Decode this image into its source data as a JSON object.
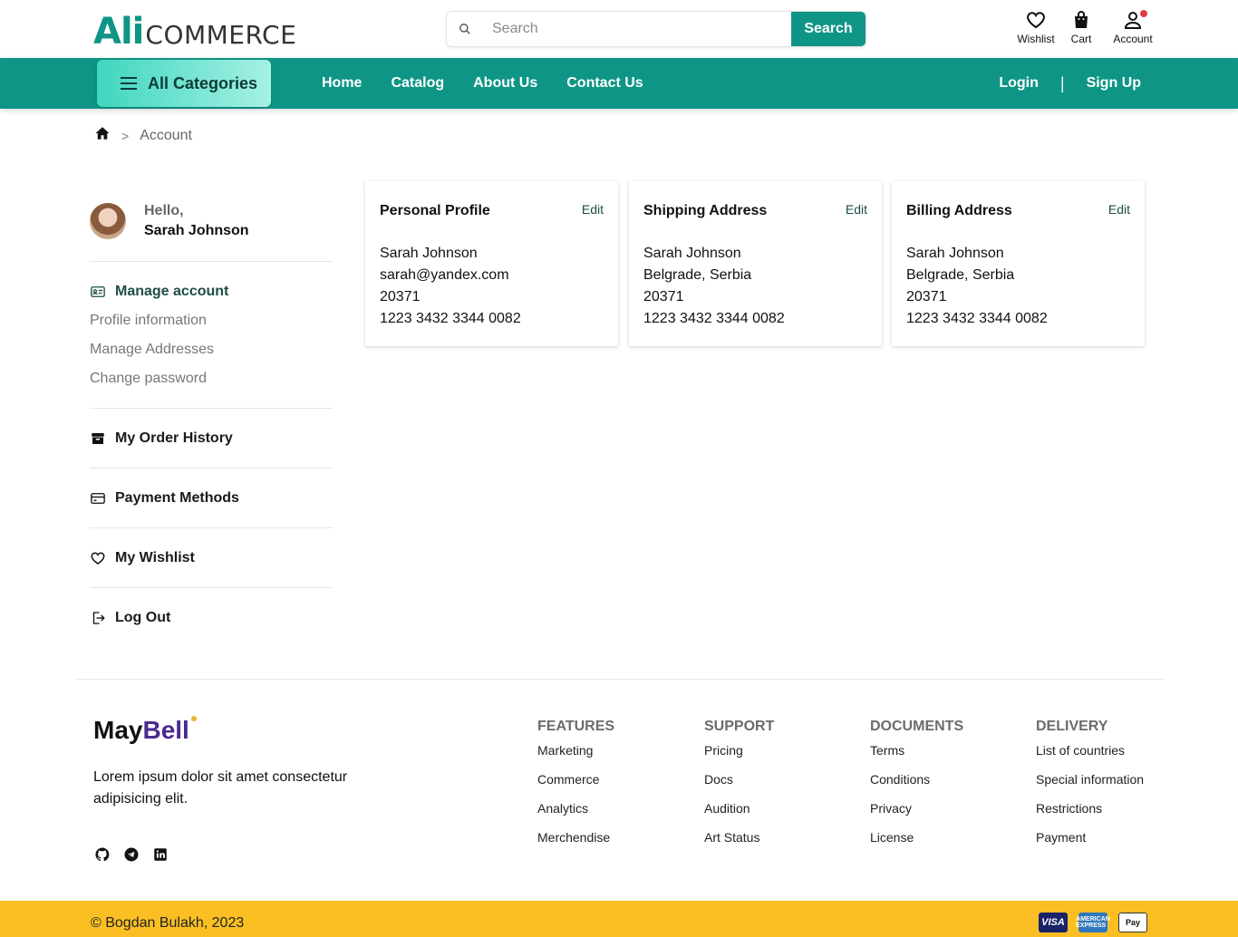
{
  "header": {
    "logo_ali": "Ali",
    "logo_commerce": "COMMERCE",
    "search_placeholder": "Search",
    "search_button": "Search",
    "icons": [
      {
        "label": "Wishlist",
        "icon": "heart-icon"
      },
      {
        "label": "Cart",
        "icon": "bag-icon"
      },
      {
        "label": "Account",
        "icon": "user-icon",
        "badge": true
      }
    ]
  },
  "nav": {
    "all_categories": "All Categories",
    "links": [
      "Home",
      "Catalog",
      "About Us",
      "Contact Us"
    ],
    "login": "Login",
    "separator": "|",
    "signup": "Sign Up"
  },
  "breadcrumb": {
    "separator": ">",
    "current": "Account"
  },
  "sidebar": {
    "greeting": "Hello,",
    "user_name": "Sarah Johnson",
    "manage_account": "Manage account",
    "sub_items": [
      "Profile information",
      "Manage Addresses",
      "Change password"
    ],
    "sections": [
      {
        "label": "My Order History",
        "icon": "archive-icon"
      },
      {
        "label": "Payment Methods",
        "icon": "credit-card-icon"
      },
      {
        "label": "My Wishlist",
        "icon": "heart-icon"
      },
      {
        "label": "Log Out",
        "icon": "logout-icon"
      }
    ]
  },
  "cards": [
    {
      "title": "Personal Profile",
      "edit": "Edit",
      "lines": [
        "Sarah Johnson",
        "sarah@yandex.com",
        "20371",
        "1223 3432 3344 0082"
      ]
    },
    {
      "title": "Shipping Address",
      "edit": "Edit",
      "lines": [
        "Sarah Johnson",
        "Belgrade, Serbia",
        "20371",
        "1223 3432 3344 0082"
      ]
    },
    {
      "title": "Billing Address",
      "edit": "Edit",
      "lines": [
        "Sarah Johnson",
        "Belgrade, Serbia",
        "20371",
        "1223 3432 3344 0082"
      ]
    }
  ],
  "footer": {
    "brand_may": "May",
    "brand_bell": "Bell",
    "description": "Lorem ipsum dolor sit amet consectetur adipisicing elit.",
    "socials": [
      "github-icon",
      "telegram-icon",
      "linkedin-icon"
    ],
    "columns": [
      {
        "title": "FEATURES",
        "items": [
          "Marketing",
          "Commerce",
          "Analytics",
          "Merchendise"
        ]
      },
      {
        "title": "SUPPORT",
        "items": [
          "Pricing",
          "Docs",
          "Audition",
          "Art Status"
        ]
      },
      {
        "title": "DOCUMENTS",
        "items": [
          "Terms",
          "Conditions",
          "Privacy",
          "License"
        ]
      },
      {
        "title": "DELIVERY",
        "items": [
          "List of countries",
          "Special information",
          "Restrictions",
          "Payment"
        ]
      }
    ],
    "copyright": "© Bogdan Bulakh, 2023",
    "payments": [
      "VISA",
      "AMERICAN EXPRESS",
      "Pay"
    ]
  },
  "colors": {
    "primary": "#0f9586",
    "accent_yellow": "#fbbf24",
    "brand_purple": "#4a2a8f"
  }
}
